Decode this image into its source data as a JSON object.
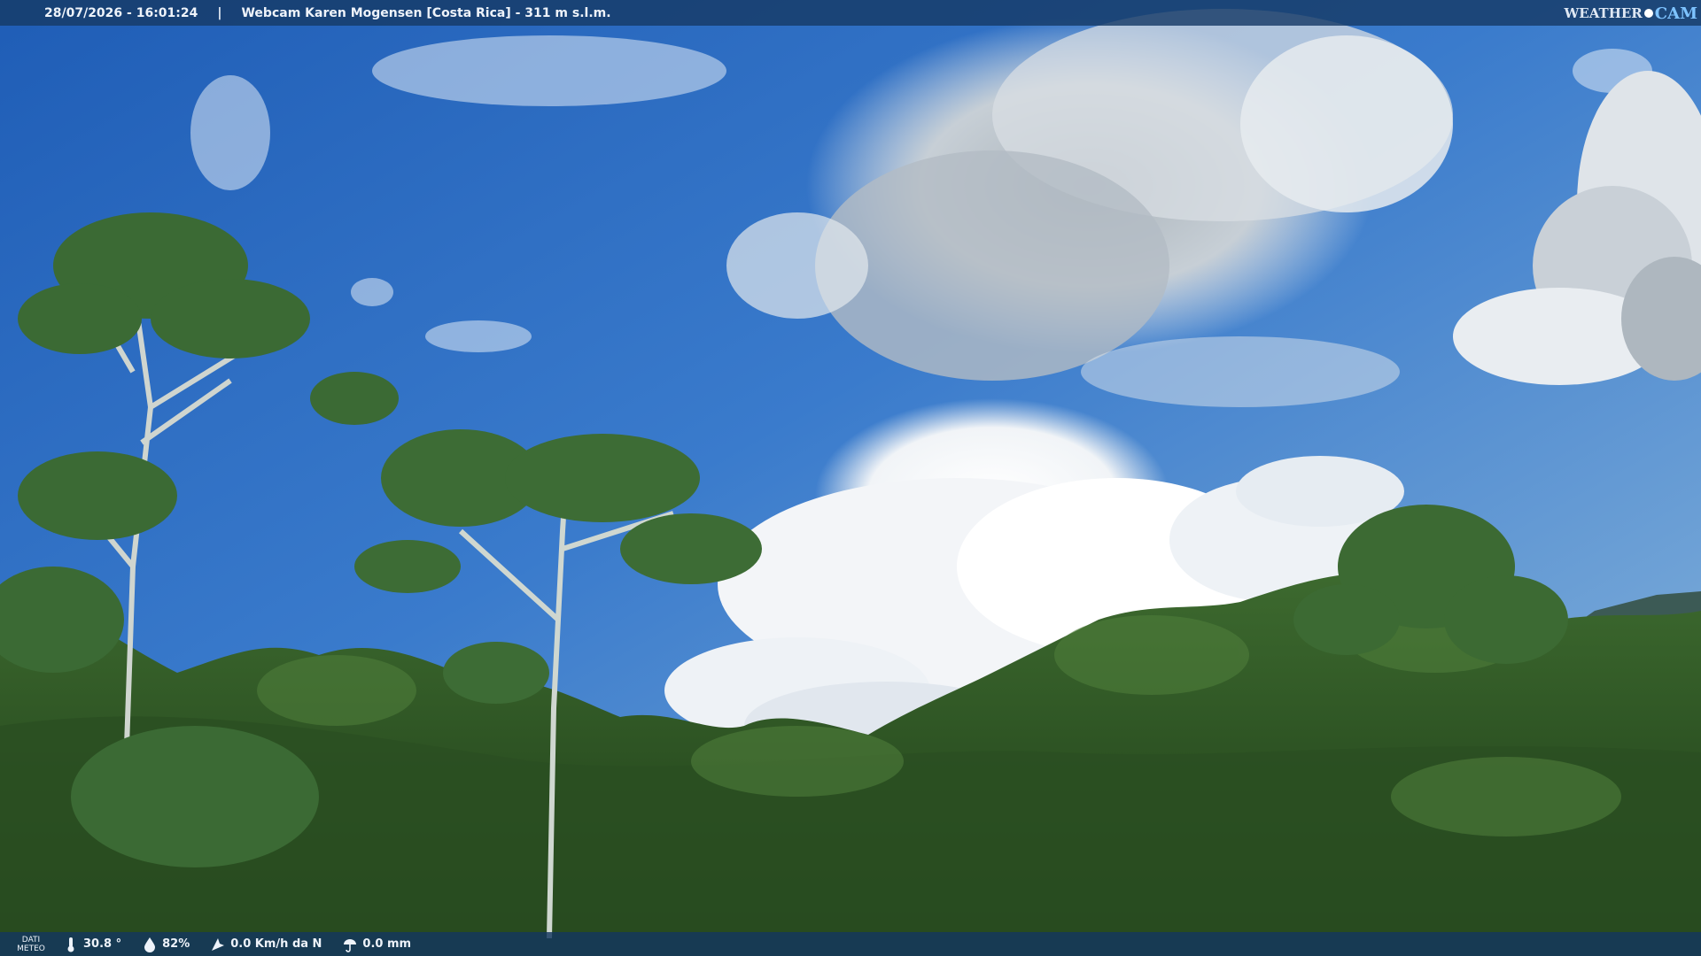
{
  "header": {
    "timestamp": "28/07/2026 - 16:01:24",
    "separator": "|",
    "title": "Webcam Karen Mogensen [Costa Rica] - 311 m s.l.m."
  },
  "logo": {
    "weather": "WEATHER",
    "cam": "CAM"
  },
  "footer": {
    "label_line1": "DATI",
    "label_line2": "METEO",
    "temperature": "30.8 °",
    "humidity": "82%",
    "wind": "0.0 Km/h da N",
    "rain": "0.0 mm"
  },
  "icons": {
    "temperature": "thermometer-icon",
    "humidity": "humidity-drop-icon",
    "wind": "wind-icon",
    "rain": "rain-icon"
  }
}
